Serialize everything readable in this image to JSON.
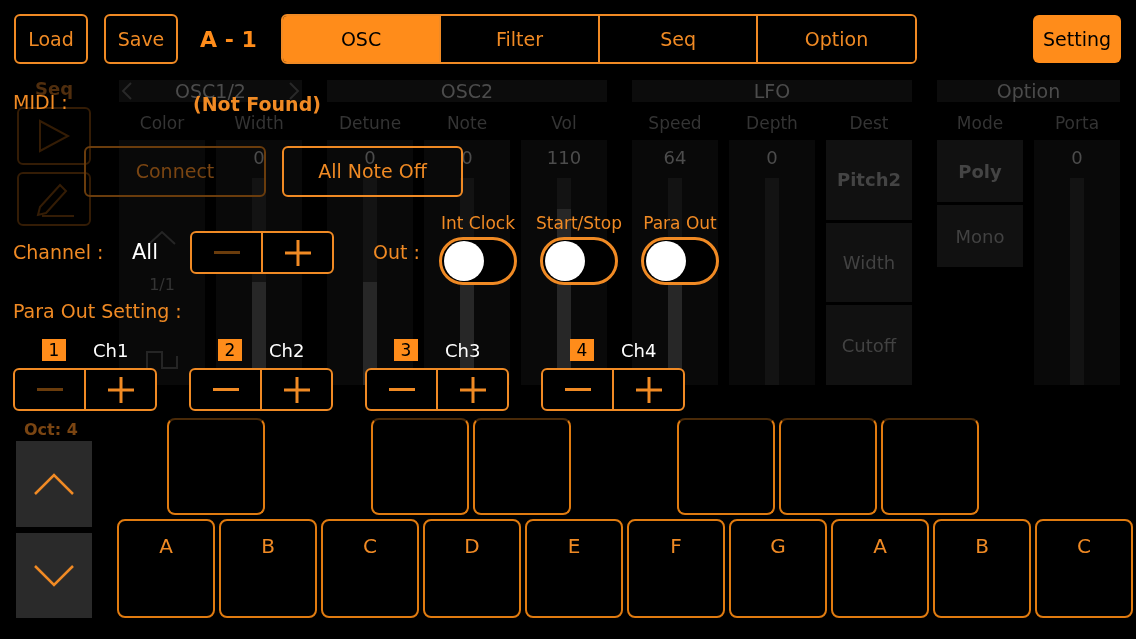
{
  "toolbar": {
    "load": "Load",
    "save": "Save",
    "preset": "A - 1",
    "tabs": [
      {
        "label": "OSC",
        "selected": true
      },
      {
        "label": "Filter",
        "selected": false
      },
      {
        "label": "Seq",
        "selected": false
      },
      {
        "label": "Option",
        "selected": false
      }
    ],
    "setting": {
      "label": "Setting",
      "active": true
    }
  },
  "background": {
    "sidebar_label": "Seq",
    "sections": [
      {
        "title": "OSC1/2",
        "arrows": true,
        "columns": [
          {
            "label": "Color",
            "kind": "waveform",
            "page": "1/1"
          },
          {
            "label": "Width",
            "kind": "slider",
            "value": "0",
            "level": 0.5
          }
        ]
      },
      {
        "title": "OSC2",
        "arrows": false,
        "columns": [
          {
            "label": "Detune",
            "kind": "slider",
            "value": "0",
            "level": 0.5
          },
          {
            "label": "Note",
            "kind": "slider",
            "value": "0",
            "level": 0.5
          },
          {
            "label": "Vol",
            "kind": "slider",
            "value": "110",
            "level": 0.85
          }
        ]
      },
      {
        "title": "LFO",
        "arrows": false,
        "columns": [
          {
            "label": "Speed",
            "kind": "slider",
            "value": "64",
            "level": 0.5
          },
          {
            "label": "Depth",
            "kind": "slider",
            "value": "0",
            "level": 0
          },
          {
            "label": "Dest",
            "kind": "choice",
            "options": [
              {
                "label": "Pitch2",
                "selected": true
              },
              {
                "label": "Width",
                "selected": false
              },
              {
                "label": "Cutoff",
                "selected": false
              }
            ]
          }
        ]
      },
      {
        "title": "Option",
        "arrows": false,
        "columns": [
          {
            "label": "Mode",
            "kind": "choice",
            "options": [
              {
                "label": "Poly",
                "selected": true
              },
              {
                "label": "Mono",
                "selected": false
              }
            ]
          },
          {
            "label": "Porta",
            "kind": "slider",
            "value": "0",
            "level": 0
          }
        ]
      }
    ]
  },
  "midi_settings": {
    "midi_label": "MIDI :",
    "device_status": "(Not Found)",
    "buttons": [
      {
        "label": "Connect",
        "disabled": true
      },
      {
        "label": "All Note Off",
        "disabled": false
      }
    ],
    "channel_label": "Channel :",
    "channel_value": "All",
    "channel_minus_disabled": true,
    "out_label": "Out :",
    "toggles": [
      {
        "label": "Int Clock",
        "on": false
      },
      {
        "label": "Start/Stop",
        "on": false
      },
      {
        "label": "Para Out",
        "on": false
      }
    ],
    "para_out_label": "Para Out Setting :",
    "para_channels": [
      {
        "number": "1",
        "channel": "Ch1",
        "minus_disabled": true
      },
      {
        "number": "2",
        "channel": "Ch2",
        "minus_disabled": false
      },
      {
        "number": "3",
        "channel": "Ch3",
        "minus_disabled": false
      },
      {
        "number": "4",
        "channel": "Ch4",
        "minus_disabled": false
      }
    ]
  },
  "keyboard": {
    "octave_label": "Oct: 4",
    "keys": [
      {
        "note": "A",
        "sharp": true
      },
      {
        "note": "B",
        "sharp": false
      },
      {
        "note": "C",
        "sharp": true
      },
      {
        "note": "D",
        "sharp": true
      },
      {
        "note": "E",
        "sharp": false
      },
      {
        "note": "F",
        "sharp": true
      },
      {
        "note": "G",
        "sharp": true
      },
      {
        "note": "A",
        "sharp": true
      },
      {
        "note": "B",
        "sharp": false
      },
      {
        "note": "C",
        "sharp": false
      }
    ]
  }
}
